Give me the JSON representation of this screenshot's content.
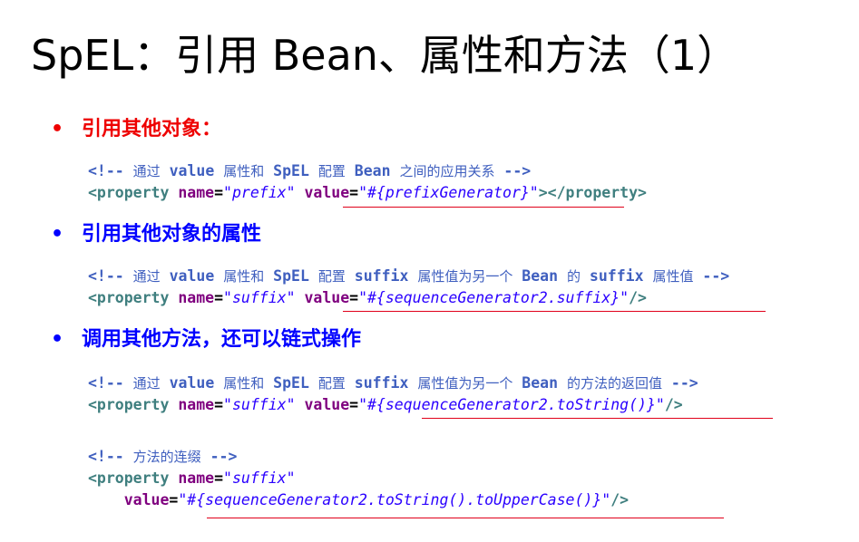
{
  "slide": {
    "title": "SpEL：引用 Bean、属性和方法（1）"
  },
  "sections": [
    {
      "bullet": "•",
      "heading": "引用其他对象：",
      "heading_color": "#ee0000",
      "comment": {
        "open": "<!-- ",
        "t1": "通过",
        "k1": " value ",
        "t2": "属性和",
        "k2": " SpEL ",
        "t3": "配置",
        "k3": " Bean ",
        "t4": "之间的应用关系",
        "close": " -->"
      },
      "line": {
        "tag_open": "<property",
        "attr1": "name",
        "eq1": "=",
        "val1": "\"prefix\"",
        "attr2": "value",
        "eq2": "=",
        "val2": "\"#{prefixGenerator}\"",
        "tag_close": "></property>"
      }
    },
    {
      "bullet": "•",
      "heading": "引用其他对象的属性",
      "heading_color": "#0000ff",
      "comment": {
        "open": "<!-- ",
        "t1": "通过",
        "k1": " value ",
        "t2": "属性和",
        "k2": " SpEL ",
        "t3": "配置",
        "k3": " suffix ",
        "t4": "属性值为另一个",
        "k4": " Bean ",
        "t5": "的",
        "k5": " suffix ",
        "t6": "属性值",
        "close": " -->"
      },
      "line": {
        "tag_open": "<property",
        "attr1": "name",
        "eq1": "=",
        "val1": "\"suffix\"",
        "attr2": "value",
        "eq2": "=",
        "val2": "\"#{sequenceGenerator2.suffix}\"",
        "tag_close": "/>"
      }
    },
    {
      "bullet": "•",
      "heading": "调用其他方法，还可以链式操作",
      "heading_color": "#0000ff",
      "comment": {
        "open": "<!-- ",
        "t1": "通过",
        "k1": " value ",
        "t2": "属性和",
        "k2": " SpEL ",
        "t3": "配置",
        "k3": " suffix ",
        "t4": "属性值为另一个",
        "k4": " Bean ",
        "t5": "的方法的返回值",
        "close": " -->"
      },
      "line": {
        "tag_open": "<property",
        "attr1": "name",
        "eq1": "=",
        "val1": "\"suffix\"",
        "attr2": "value",
        "eq2": "=",
        "val2": "\"#{sequenceGenerator2.toString()}\"",
        "tag_close": "/>"
      }
    },
    {
      "comment": {
        "open": "<!-- ",
        "t1": "方法的连缀",
        "close": " -->"
      },
      "line1": {
        "tag_open": "<property",
        "attr1": "name",
        "eq1": "=",
        "val1": "\"suffix\""
      },
      "line2": {
        "indent": "    ",
        "attr2": "value",
        "eq2": "=",
        "val2": "\"#{sequenceGenerator2.toString().toUpperCase()}\"",
        "tag_close": "/>"
      }
    }
  ],
  "colors": {
    "comment": "#3f5fbf",
    "tag": "#3f7f7f",
    "attribute": "#7f007f",
    "string": "#2a00ff",
    "underline": "#e0001a"
  }
}
